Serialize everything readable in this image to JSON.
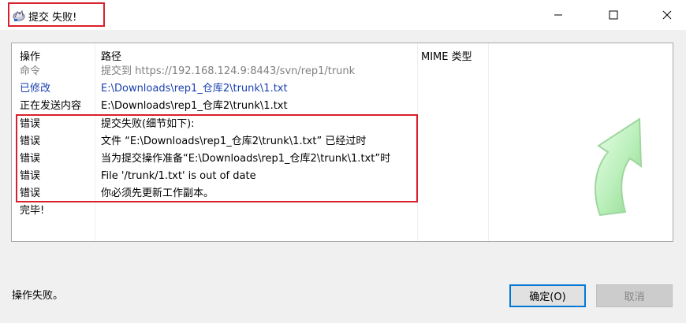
{
  "window": {
    "title": "提交 失败!",
    "app_icon": "tortoise-svn-icon",
    "controls": [
      "minimize-icon",
      "maximize-icon",
      "close-icon"
    ]
  },
  "log": {
    "headers": {
      "action": "操作",
      "path": "路径",
      "mime": "MIME 类型"
    },
    "rows": [
      {
        "action": "命令",
        "path": "提交到 https://192.168.124.9:8443/svn/rep1/trunk",
        "color": "#808080"
      },
      {
        "action": "已修改",
        "path": "E:\\Downloads\\rep1_仓库2\\trunk\\1.txt",
        "color": "#1a3fb0"
      },
      {
        "action": "正在发送内容",
        "path": "E:\\Downloads\\rep1_仓库2\\trunk\\1.txt",
        "color": "#000000"
      },
      {
        "action": "错误",
        "path": "提交失败(细节如下):",
        "color": "#000000"
      },
      {
        "action": "错误",
        "path": "文件 “E:\\Downloads\\rep1_仓库2\\trunk\\1.txt” 已经过时",
        "color": "#000000"
      },
      {
        "action": "错误",
        "path": "当为提交操作准备“E:\\Downloads\\rep1_仓库2\\trunk\\1.txt”时",
        "color": "#000000"
      },
      {
        "action": "错误",
        "path": "File '/trunk/1.txt' is out of date",
        "color": "#000000"
      },
      {
        "action": "错误",
        "path": "你必须先更新工作副本。",
        "color": "#000000"
      },
      {
        "action": "完毕!",
        "path": "",
        "color": "#000000"
      }
    ],
    "progress_graphic": "green-commit-arrow-icon"
  },
  "footer": {
    "status": "操作失败。",
    "ok_label": "确定(O)",
    "cancel_label": "取消"
  },
  "colors": {
    "highlight_border": "#d9202a",
    "focus_border": "#0078d7"
  }
}
